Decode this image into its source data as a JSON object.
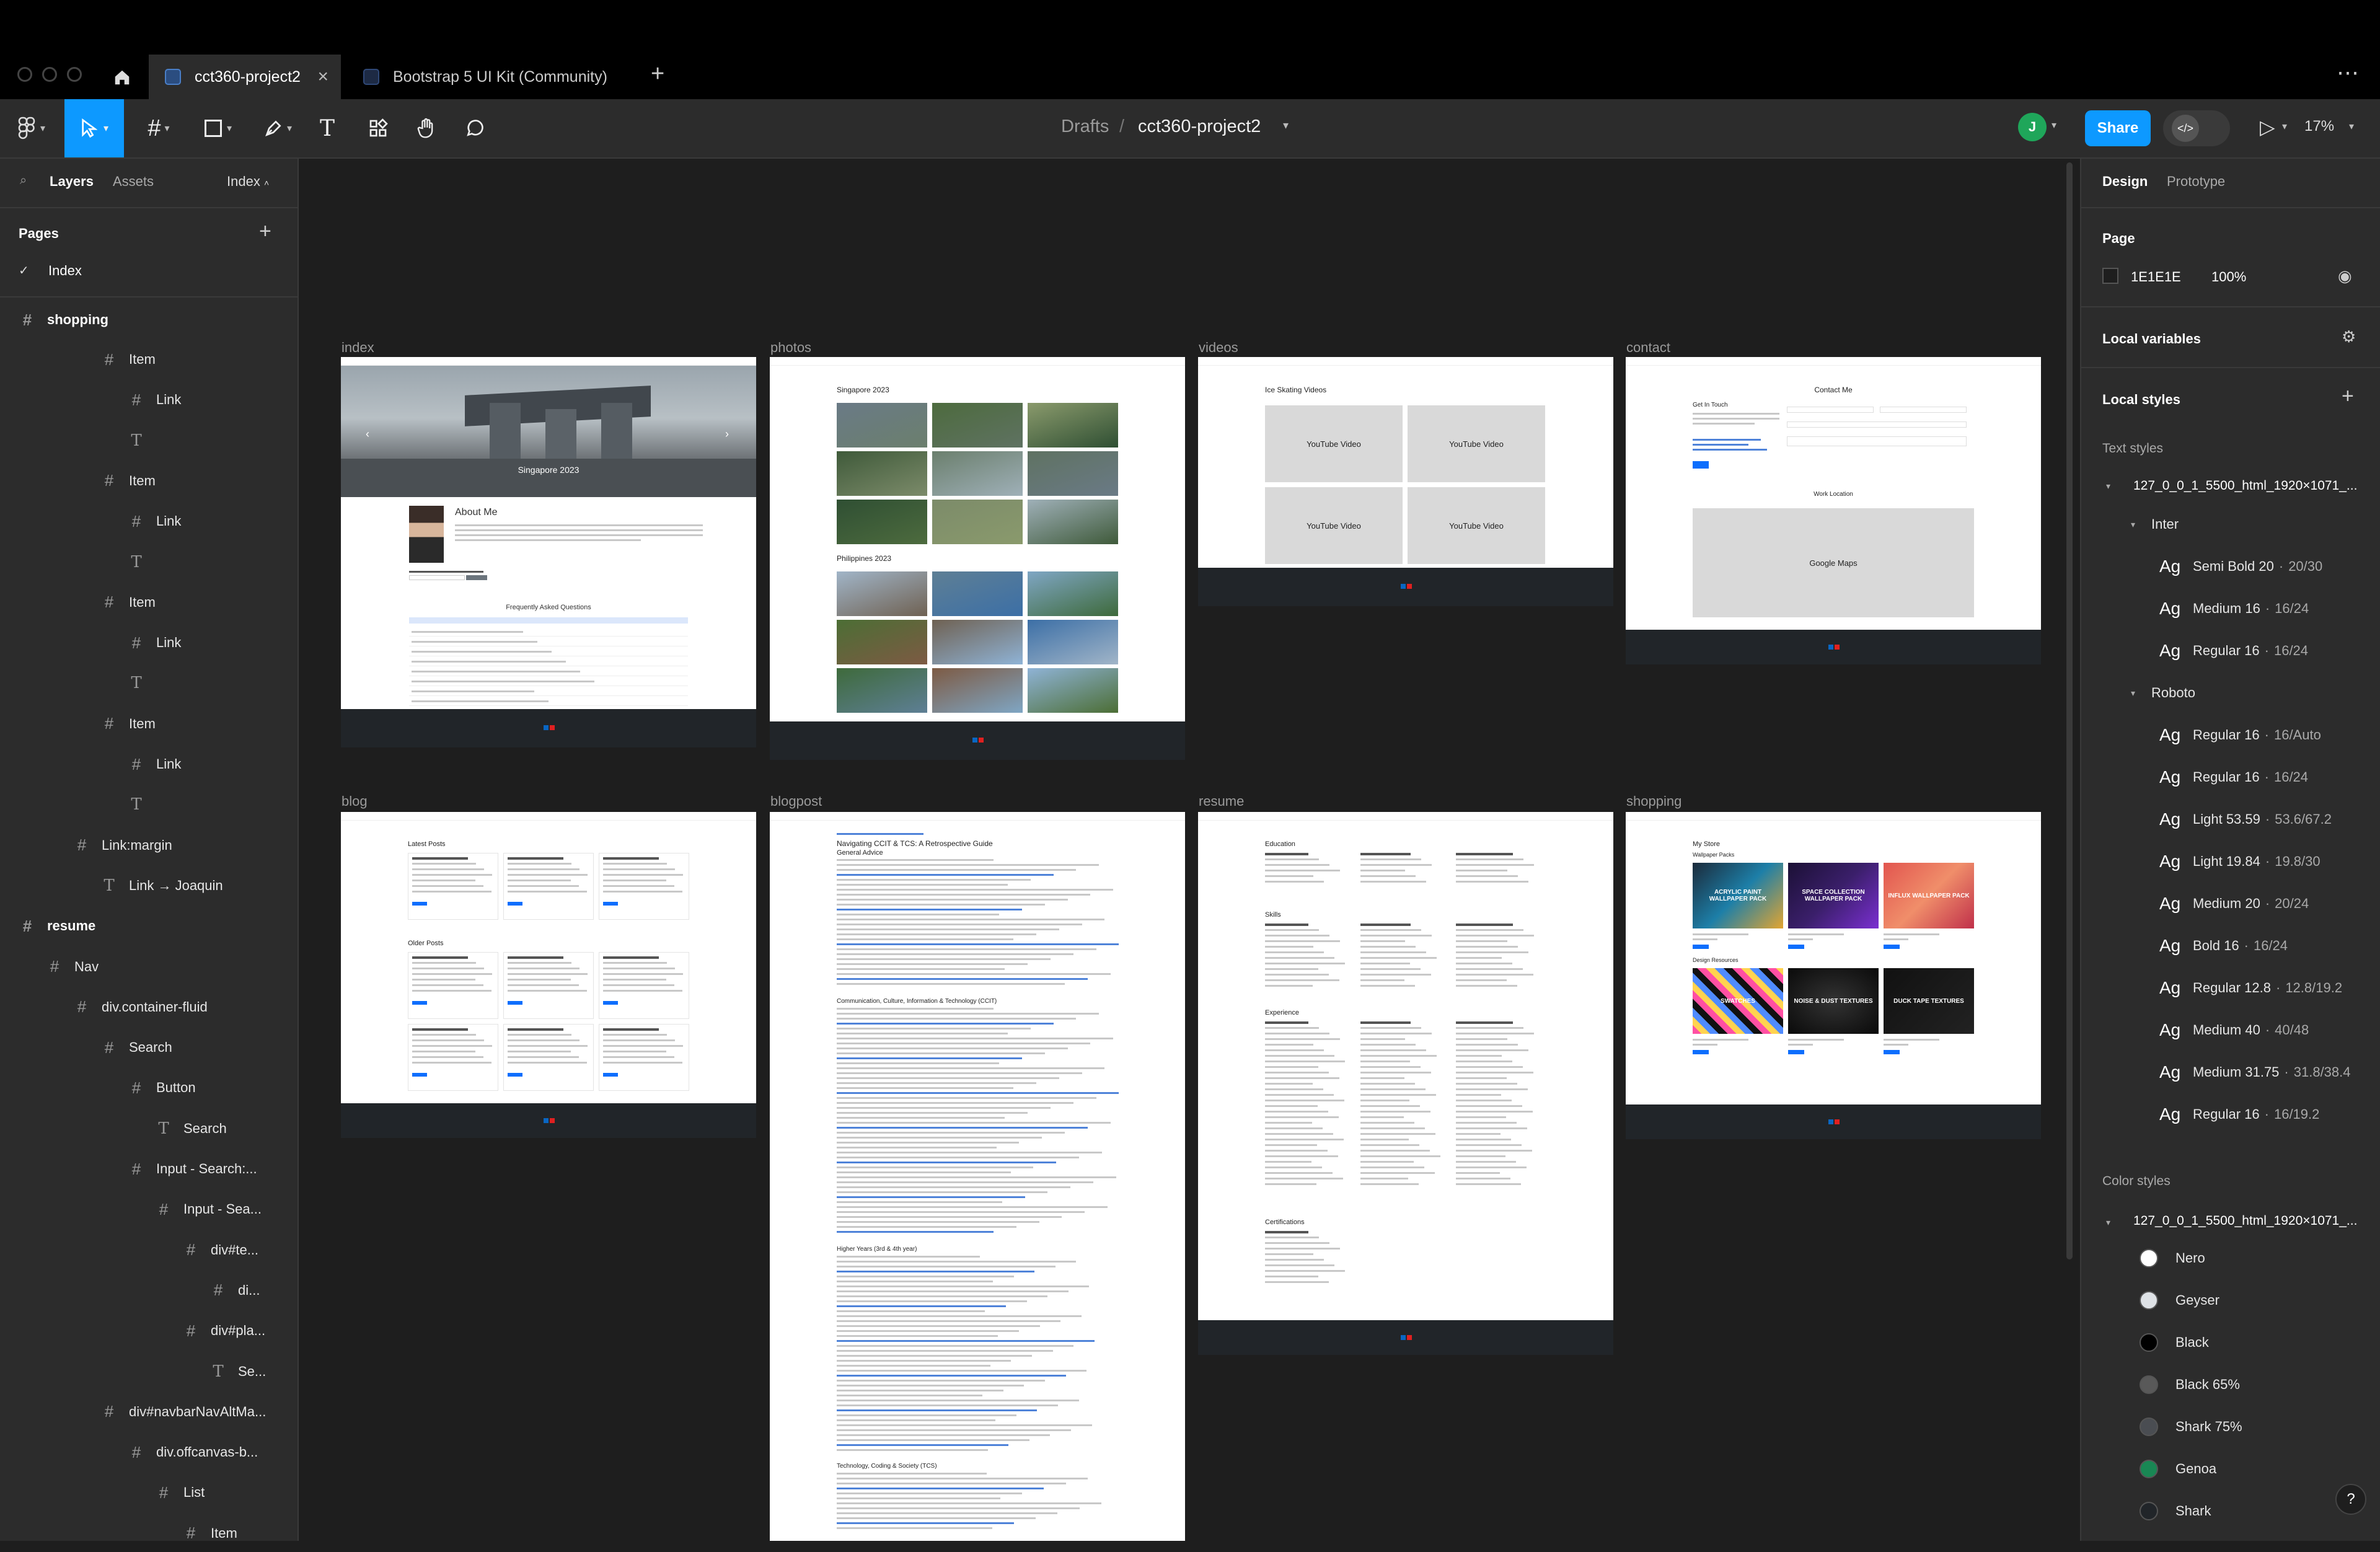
{
  "tabs": [
    {
      "label": "cct360-project2",
      "active": true
    },
    {
      "label": "Bootstrap 5 UI Kit (Community)",
      "active": false
    }
  ],
  "toolbar": {
    "breadcrumb_parent": "Drafts",
    "separator": "/",
    "file_name": "cct360-project2",
    "avatar_initial": "J",
    "share_label": "Share",
    "zoom": "17%"
  },
  "left_panel": {
    "tab_layers": "Layers",
    "tab_assets": "Assets",
    "page_selector": "Index",
    "pages_heading": "Pages",
    "pages": [
      {
        "label": "Index",
        "selected": true
      }
    ],
    "layers": [
      {
        "label": "shopping",
        "kind": "frame",
        "indent": 0,
        "bold": true
      },
      {
        "label": "Item",
        "kind": "hash",
        "indent": 3
      },
      {
        "label": "Link",
        "kind": "hash",
        "indent": 4
      },
      {
        "label": "",
        "kind": "text",
        "indent": 4
      },
      {
        "label": "Item",
        "kind": "hash",
        "indent": 3
      },
      {
        "label": "Link",
        "kind": "hash",
        "indent": 4
      },
      {
        "label": "",
        "kind": "text",
        "indent": 4
      },
      {
        "label": "Item",
        "kind": "hash",
        "indent": 3
      },
      {
        "label": "Link",
        "kind": "hash",
        "indent": 4
      },
      {
        "label": "",
        "kind": "text",
        "indent": 4
      },
      {
        "label": "Item",
        "kind": "hash",
        "indent": 3
      },
      {
        "label": "Link",
        "kind": "hash",
        "indent": 4
      },
      {
        "label": "",
        "kind": "text",
        "indent": 4
      },
      {
        "label": "Link:margin",
        "kind": "hash",
        "indent": 2
      },
      {
        "label": "Link → Joaquin",
        "kind": "text",
        "indent": 3
      },
      {
        "label": "resume",
        "kind": "frame",
        "indent": 0,
        "bold": true
      },
      {
        "label": "Nav",
        "kind": "hash",
        "indent": 1
      },
      {
        "label": "div.container-fluid",
        "kind": "hash",
        "indent": 2
      },
      {
        "label": "Search",
        "kind": "hash",
        "indent": 3
      },
      {
        "label": "Button",
        "kind": "hash",
        "indent": 4
      },
      {
        "label": "Search",
        "kind": "text",
        "indent": 5
      },
      {
        "label": "Input - Search:...",
        "kind": "hash",
        "indent": 4
      },
      {
        "label": "Input - Sea...",
        "kind": "hash",
        "indent": 5
      },
      {
        "label": "div#te...",
        "kind": "hash",
        "indent": 6
      },
      {
        "label": "di...",
        "kind": "hash",
        "indent": 7
      },
      {
        "label": "div#pla...",
        "kind": "hash",
        "indent": 6
      },
      {
        "label": "Se...",
        "kind": "text",
        "indent": 7
      },
      {
        "label": "div#navbarNavAltMa...",
        "kind": "hash",
        "indent": 3
      },
      {
        "label": "div.offcanvas-b...",
        "kind": "hash",
        "indent": 4
      },
      {
        "label": "List",
        "kind": "hash",
        "indent": 5
      },
      {
        "label": "Item",
        "kind": "hash",
        "indent": 6
      }
    ]
  },
  "right_panel": {
    "tab_design": "Design",
    "tab_prototype": "Prototype",
    "page_heading": "Page",
    "page_color_hex": "1E1E1E",
    "page_color": "#1E1E1E",
    "page_opacity": "100%",
    "local_variables": "Local variables",
    "local_styles": "Local styles",
    "text_styles_heading": "Text styles",
    "text_style_group": "127_0_0_1_5500_html_1920×1071_...",
    "font_groups": [
      {
        "name": "Inter",
        "styles": [
          {
            "glyph": "Ag",
            "label": "Semi Bold 20",
            "meta": "20/30"
          },
          {
            "glyph": "Ag",
            "label": "Medium 16",
            "meta": "16/24"
          },
          {
            "glyph": "Ag",
            "label": "Regular 16",
            "meta": "16/24"
          }
        ]
      },
      {
        "name": "Roboto",
        "styles": [
          {
            "glyph": "Ag",
            "label": "Regular 16",
            "meta": "16/Auto"
          },
          {
            "glyph": "Ag",
            "label": "Regular 16",
            "meta": "16/24"
          },
          {
            "glyph": "Ag",
            "label": "Light 53.59",
            "meta": "53.6/67.2"
          },
          {
            "glyph": "Ag",
            "label": "Light 19.84",
            "meta": "19.8/30"
          },
          {
            "glyph": "Ag",
            "label": "Medium 20",
            "meta": "20/24"
          },
          {
            "glyph": "Ag",
            "label": "Bold 16",
            "meta": "16/24"
          },
          {
            "glyph": "Ag",
            "label": "Regular 12.8",
            "meta": "12.8/19.2"
          },
          {
            "glyph": "Ag",
            "label": "Medium 40",
            "meta": "40/48"
          },
          {
            "glyph": "Ag",
            "label": "Medium 31.75",
            "meta": "31.8/38.4"
          },
          {
            "glyph": "Ag",
            "label": "Regular 16",
            "meta": "16/19.2"
          }
        ]
      }
    ],
    "color_styles_heading": "Color styles",
    "color_style_group": "127_0_0_1_5500_html_1920×1071_...",
    "colors": [
      {
        "name": "Nero",
        "hex": "#FFFFFF"
      },
      {
        "name": "Geyser",
        "hex": "#DEE2E6"
      },
      {
        "name": "Black",
        "hex": "#000000"
      },
      {
        "name": "Black 65%",
        "hex": "#595959"
      },
      {
        "name": "Shark 75%",
        "hex": "#4a4d52"
      },
      {
        "name": "Genoa",
        "hex": "#198754"
      },
      {
        "name": "Shark",
        "hex": "#212529"
      }
    ],
    "help": "?"
  },
  "canvas": {
    "frames": [
      {
        "label": "index"
      },
      {
        "label": "photos"
      },
      {
        "label": "videos"
      },
      {
        "label": "contact"
      },
      {
        "label": "blog"
      },
      {
        "label": "blogpost"
      },
      {
        "label": "resume"
      },
      {
        "label": "shopping"
      }
    ],
    "index": {
      "hero_title": "Singapore 2023",
      "about_heading": "About Me",
      "faq_heading": "Frequently Asked Questions"
    },
    "photos": {
      "section1": "Singapore 2023",
      "section2": "Philippines 2023"
    },
    "videos": {
      "heading": "Ice Skating Videos",
      "video_label": "YouTube Video"
    },
    "contact": {
      "heading": "Contact Me",
      "get_in_touch": "Get In Touch",
      "work_location": "Work Location",
      "map_label": "Google Maps"
    },
    "blog": {
      "latest": "Latest Posts",
      "older": "Older Posts"
    },
    "blogpost": {
      "title": "Navigating CCIT & TCS: A Retrospective Guide",
      "subtitle": "General Advice",
      "section1": "Communication, Culture, Information & Technology (CCIT)",
      "section2": "Higher Years (3rd & 4th year)",
      "section3": "Technology, Coding & Society (TCS)"
    },
    "resume": {
      "education": "Education",
      "skills": "Skills",
      "experience": "Experience",
      "certifications": "Certifications"
    },
    "shopping": {
      "heading": "My Store",
      "wallpaper_heading": "Wallpaper Packs",
      "resources_heading": "Design Resources",
      "wallpapers": [
        "ACRYLIC PAINT WALLPAPER PACK",
        "SPACE COLLECTION WALLPAPER PACK",
        "INFLUX WALLPAPER PACK"
      ],
      "resources": [
        "SWATCHES",
        "NOISE & DUST TEXTURES",
        "DUCK TAPE TEXTURES"
      ]
    }
  }
}
